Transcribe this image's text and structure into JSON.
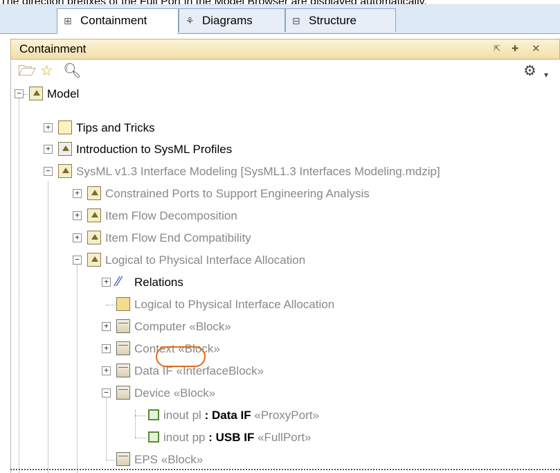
{
  "caption": "The direction prefixes of the Full Port in the Model Browser are displayed automatically.",
  "tabs": [
    {
      "label": "Containment",
      "icon": "containment-icon",
      "active": true
    },
    {
      "label": "Diagrams",
      "icon": "diagrams-icon",
      "active": false
    },
    {
      "label": "Structure",
      "icon": "structure-icon",
      "active": false
    }
  ],
  "panel": {
    "title": "Containment"
  },
  "tree": {
    "model": "Model",
    "tips": "Tips and Tricks",
    "intro": "Introduction to SysML Profiles",
    "sysml": "SysML v1.3 Interface Modeling [SysML1.3 Interfaces Modeling.mdzip]",
    "constrained": "Constrained Ports to Support Engineering Analysis",
    "itemflowdecomp": "Item Flow Decomposition",
    "itemflowend": "Item Flow End Compatibility",
    "logical": "Logical to Physical Interface Allocation",
    "relations": "Relations",
    "logicaldiag": "Logical to Physical Interface Allocation",
    "computer": "Computer",
    "computer_st": "«Block»",
    "context": "Context",
    "context_st": "«Block»",
    "dataif": "Data IF",
    "dataif_st": "«InterfaceBlock»",
    "device": "Device",
    "device_st": "«Block»",
    "port1_dir": "inout",
    "port1_name": " pl",
    "port1_type": " : Data IF",
    "port1_st": "«ProxyPort»",
    "port2_dir": "inout",
    "port2_name": " pp",
    "port2_type": " : USB IF",
    "port2_st": "«FullPort»",
    "eps": "EPS",
    "eps_st": "«Block»"
  },
  "colors": {
    "highlight_circle": "#e06b1f",
    "header_bg": "#f2deaa",
    "tab_bg": "#dde9f7"
  }
}
